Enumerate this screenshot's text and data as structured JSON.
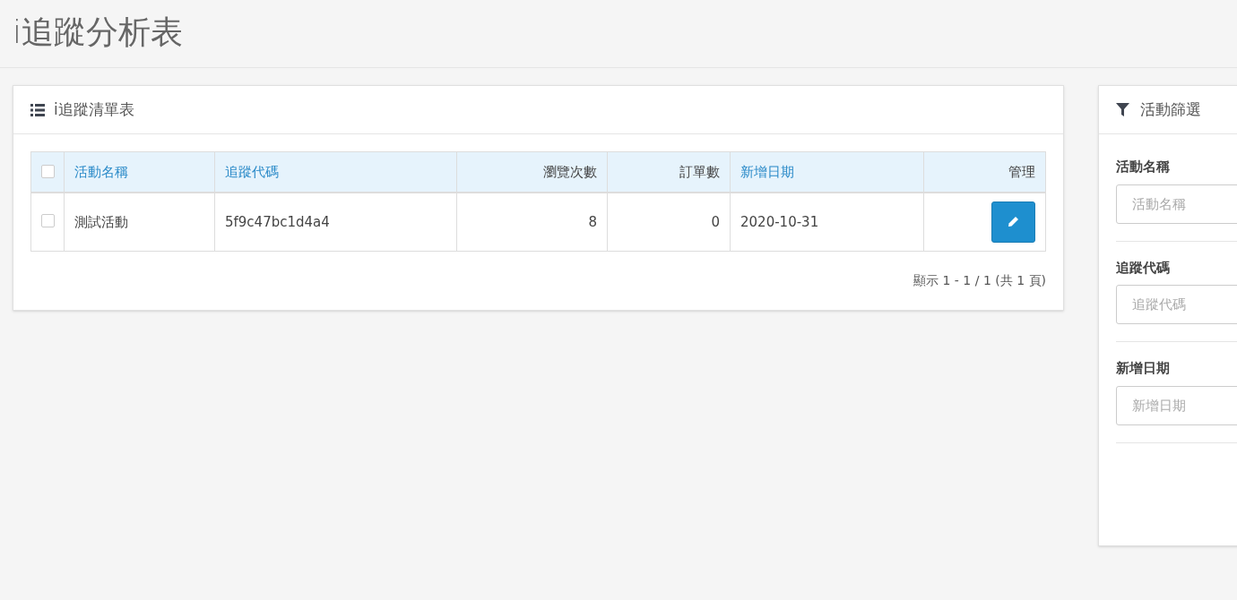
{
  "page_title": "i追蹤分析表",
  "list_panel": {
    "title": "i追蹤清單表",
    "table": {
      "select_all": {
        "checked": false
      },
      "columns": [
        {
          "label": "活動名稱",
          "sortable": true,
          "kind": "text"
        },
        {
          "label": "追蹤代碼",
          "sortable": true,
          "kind": "text"
        },
        {
          "label": "瀏覽次數",
          "sortable": false,
          "kind": "number"
        },
        {
          "label": "訂單數",
          "sortable": false,
          "kind": "number"
        },
        {
          "label": "新增日期",
          "sortable": true,
          "kind": "text"
        },
        {
          "label": "管理",
          "sortable": false,
          "kind": "action"
        }
      ],
      "rows": [
        {
          "checked": false,
          "cells": [
            "測試活動",
            "5f9c47bc1d4a4",
            "8",
            "0",
            "2020-10-31"
          ]
        }
      ]
    },
    "pagination": "顯示 1 - 1 / 1 (共 1 頁)"
  },
  "filter_panel": {
    "title": "活動篩選",
    "fields": [
      {
        "label": "活動名稱",
        "placeholder": "活動名稱"
      },
      {
        "label": "追蹤代碼",
        "placeholder": "追蹤代碼"
      },
      {
        "label": "新增日期",
        "placeholder": "新增日期"
      }
    ]
  }
}
